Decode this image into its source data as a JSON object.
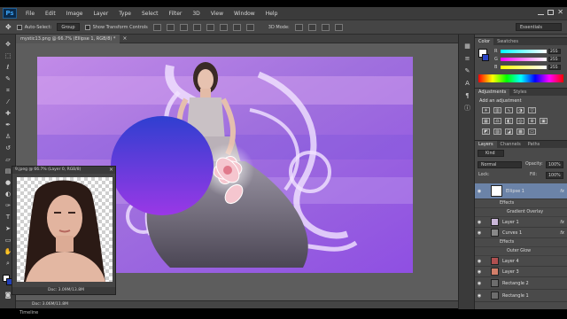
{
  "app": {
    "logo": "Ps"
  },
  "menus": [
    "File",
    "Edit",
    "Image",
    "Layer",
    "Type",
    "Select",
    "Filter",
    "3D",
    "View",
    "Window",
    "Help"
  ],
  "options": {
    "auto_select_label": "Auto-Select:",
    "auto_select_value": "Group",
    "transform_label": "Show Transform Controls",
    "mode_3d_label": "3D Mode:",
    "workspace": "Essentials"
  },
  "document_tab": "mystic13.png @ 66.7% (Ellipse 1, RGB/8) *",
  "float_window": {
    "title": "9.jpeg @ 66.7% (Layer 0, RGB/8)",
    "status": "Doc: 3.09M/13.8M"
  },
  "status_bar": "Doc: 3.06M/11.8M",
  "timeline_tab": "Timeline",
  "color_panel": {
    "tabs": [
      "Color",
      "Swatches"
    ],
    "sliders": [
      {
        "label": "R",
        "value": "255"
      },
      {
        "label": "G",
        "value": "255"
      },
      {
        "label": "B",
        "value": "255"
      }
    ]
  },
  "adjustments_panel": {
    "tabs": [
      "Adjustments",
      "Styles"
    ],
    "heading": "Add an adjustment"
  },
  "layers_panel": {
    "tabs": [
      "Layers",
      "Channels",
      "Paths"
    ],
    "kind_filter": "Kind",
    "blend_mode": "Normal",
    "opacity_label": "Opacity:",
    "opacity_value": "100%",
    "lock_label": "Lock:",
    "fill_label": "Fill:",
    "fill_value": "100%",
    "layers": [
      {
        "name": "Ellipse 1",
        "fx": "fx",
        "selected": true
      },
      {
        "name": "Effects",
        "type": "sub"
      },
      {
        "name": "Gradient Overlay",
        "type": "sub2"
      },
      {
        "name": "Layer 1",
        "fx": "fx"
      },
      {
        "name": "Curves 1",
        "fx": "fx"
      },
      {
        "name": "Effects",
        "type": "sub"
      },
      {
        "name": "Outer Glow",
        "type": "sub2"
      },
      {
        "name": "Layer 4"
      },
      {
        "name": "Layer 3"
      },
      {
        "name": "Rectangle 2"
      },
      {
        "name": "Rectangle 1"
      }
    ]
  },
  "colors": {
    "menubar": "#3b3b3b",
    "panel": "#4a4a4a",
    "selection": "#6b83a8",
    "ellipse_top": "#2f3fd0",
    "ellipse_bottom": "#9a38e6"
  }
}
